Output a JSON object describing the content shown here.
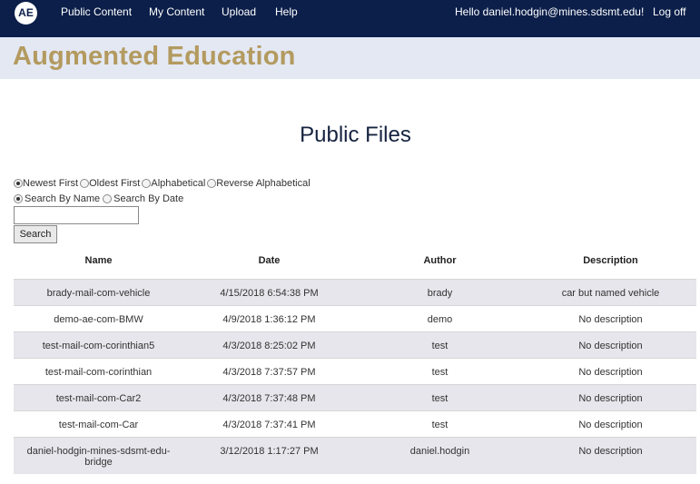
{
  "nav": {
    "logo_text": "AE",
    "links": [
      "Public Content",
      "My Content",
      "Upload",
      "Help"
    ],
    "greeting": "Hello daniel.hodgin@mines.sdsmt.edu!",
    "logoff": "Log off"
  },
  "banner": {
    "title": "Augmented Education"
  },
  "page": {
    "title": "Public Files"
  },
  "sort_options": {
    "selected": "Newest First",
    "items": [
      "Newest First",
      "Oldest First",
      "Alphabetical",
      "Reverse Alphabetical"
    ]
  },
  "search_options": {
    "selected": "Search By Name",
    "items": [
      "Search By Name",
      "Search By Date"
    ]
  },
  "search": {
    "value": "",
    "button_label": "Search"
  },
  "table": {
    "headers": [
      "Name",
      "Date",
      "Author",
      "Description"
    ],
    "rows": [
      {
        "name": "brady-mail-com-vehicle",
        "date": "4/15/2018 6:54:38 PM",
        "author": "brady",
        "description": "car but named vehicle"
      },
      {
        "name": "demo-ae-com-BMW",
        "date": "4/9/2018 1:36:12 PM",
        "author": "demo",
        "description": "No description"
      },
      {
        "name": "test-mail-com-corinthian5",
        "date": "4/3/2018 8:25:02 PM",
        "author": "test",
        "description": "No description"
      },
      {
        "name": "test-mail-com-corinthian",
        "date": "4/3/2018 7:37:57 PM",
        "author": "test",
        "description": "No description"
      },
      {
        "name": "test-mail-com-Car2",
        "date": "4/3/2018 7:37:48 PM",
        "author": "test",
        "description": "No description"
      },
      {
        "name": "test-mail-com-Car",
        "date": "4/3/2018 7:37:41 PM",
        "author": "test",
        "description": "No description"
      },
      {
        "name_lines": [
          "daniel-hodgin-mines-sdsmt-edu-",
          "bridge"
        ],
        "date": "3/12/2018 1:17:27 PM",
        "author": "daniel.hodgin",
        "description": "No description"
      }
    ]
  },
  "colors": {
    "topbar": "#0c1f4a",
    "banner_bg": "#e3e8f3",
    "banner_title": "#b39a5f",
    "row_stripe": "#e6e6ec"
  }
}
